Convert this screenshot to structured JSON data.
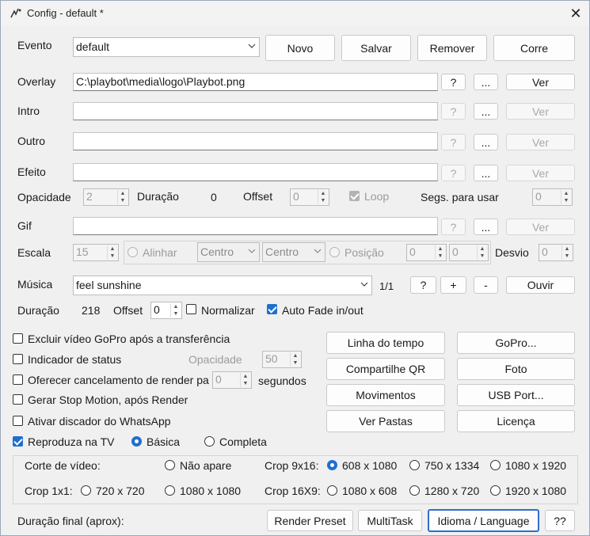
{
  "window": {
    "title": "Config - default *",
    "close_glyph": "✕"
  },
  "evento": {
    "label": "Evento",
    "value": "default",
    "novo": "Novo",
    "salvar": "Salvar",
    "remover": "Remover",
    "corre": "Corre"
  },
  "files": {
    "overlay": {
      "label": "Overlay",
      "value": "C:\\playbot\\media\\logo\\Playbot.png",
      "help": "?",
      "browse": "...",
      "ver": "Ver"
    },
    "intro": {
      "label": "Intro",
      "value": "",
      "help": "?",
      "browse": "...",
      "ver": "Ver"
    },
    "outro": {
      "label": "Outro",
      "value": "",
      "help": "?",
      "browse": "...",
      "ver": "Ver"
    },
    "efeito": {
      "label": "Efeito",
      "value": "",
      "help": "?",
      "browse": "...",
      "ver": "Ver"
    },
    "gif": {
      "label": "Gif",
      "value": "",
      "help": "?",
      "browse": "...",
      "ver": "Ver"
    }
  },
  "opacidade_row": {
    "opacidade_label": "Opacidade",
    "opacidade_value": "2",
    "duracao_label": "Duração",
    "duracao_value": "0",
    "offset_label": "Offset",
    "offset_value": "0",
    "loop_label": "Loop",
    "segs_label": "Segs. para usar",
    "segs_value": "0"
  },
  "escala_row": {
    "escala_label": "Escala",
    "escala_value": "15",
    "alinhar_label": "Alinhar",
    "align_h": "Centro",
    "align_v": "Centro",
    "posicao_label": "Posição",
    "pos_x": "0",
    "pos_y": "0",
    "desvio_label": "Desvio",
    "desvio_value": "0"
  },
  "musica": {
    "label": "Música",
    "value": "feel sunshine",
    "count": "1/1",
    "help": "?",
    "add": "+",
    "remove": "-",
    "ouvir": "Ouvir"
  },
  "duracao_row": {
    "label": "Duração",
    "value": "218",
    "offset_label": "Offset",
    "offset_value": "0",
    "normalizar_label": "Normalizar",
    "autofade_label": "Auto Fade in/out"
  },
  "options": {
    "excluir": "Excluir vídeo GoPro após a transferência",
    "indicador": "Indicador de status",
    "opacidade_label": "Opacidade",
    "opacidade_value": "50",
    "cancelamento": "Oferecer cancelamento de render pa",
    "cancel_value": "0",
    "segundos": "segundos",
    "stopmotion": "Gerar Stop Motion, após Render",
    "whatsapp": "Ativar discador do WhatsApp",
    "reproduza": "Reproduza na TV",
    "basica": "Básica",
    "completa": "Completa"
  },
  "action_buttons": {
    "linha": "Linha do tempo",
    "gopro": "GoPro...",
    "qr": "Compartilhe QR",
    "foto": "Foto",
    "movimentos": "Movimentos",
    "usb": "USB Port...",
    "pastas": "Ver Pastas",
    "licenca": "Licença"
  },
  "crop": {
    "corte_label": "Corte de vídeo:",
    "nao_apare": "Não apare",
    "crop916_label": "Crop 9x16:",
    "c916": [
      "608 x 1080",
      "750 x 1334",
      "1080 x 1920"
    ],
    "crop11_label": "Crop 1x1:",
    "c11": [
      "720 x 720",
      "1080 x 1080"
    ],
    "crop169_label": "Crop 16X9:",
    "c169": [
      "1080 x 608",
      "1280 x 720",
      "1920 x 1080"
    ]
  },
  "footer": {
    "duracao_final": "Duração final (aprox):",
    "render": "Render Preset",
    "multitask": "MultiTask",
    "idioma": "Idioma / Language",
    "help": "??"
  },
  "colors": {
    "accent": "#1f6fd0",
    "window_bg": "#f0f0f0",
    "disabled_text": "#9b9b9b"
  }
}
